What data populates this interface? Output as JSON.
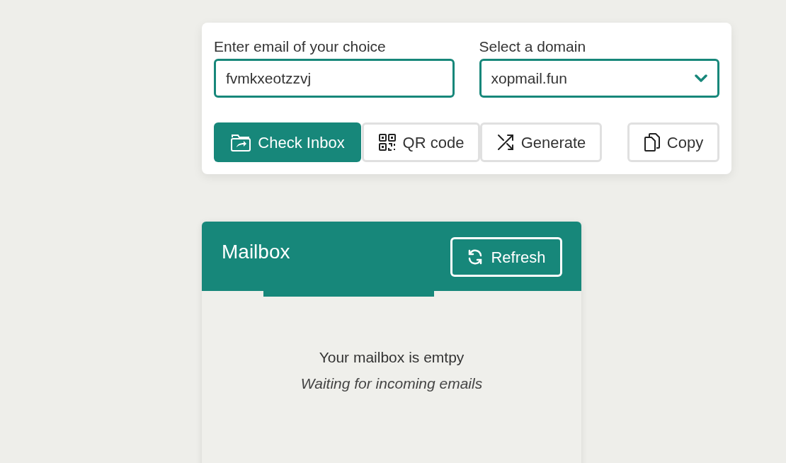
{
  "email_form": {
    "email_label": "Enter email of your choice",
    "email_value": "fvmkxeotzzvj",
    "domain_label": "Select a domain",
    "domain_value": "xopmail.fun"
  },
  "actions": [
    {
      "kind": "check_inbox",
      "label": "Check Inbox"
    },
    {
      "kind": "qr_code",
      "label": "QR code"
    },
    {
      "kind": "generate",
      "label": "Generate"
    },
    {
      "kind": "copy",
      "label": "Copy"
    }
  ],
  "mailbox": {
    "title": "Mailbox",
    "refresh_label": "Refresh",
    "empty_title": "Your mailbox is emtpy",
    "empty_subtitle": "Waiting for incoming emails"
  }
}
